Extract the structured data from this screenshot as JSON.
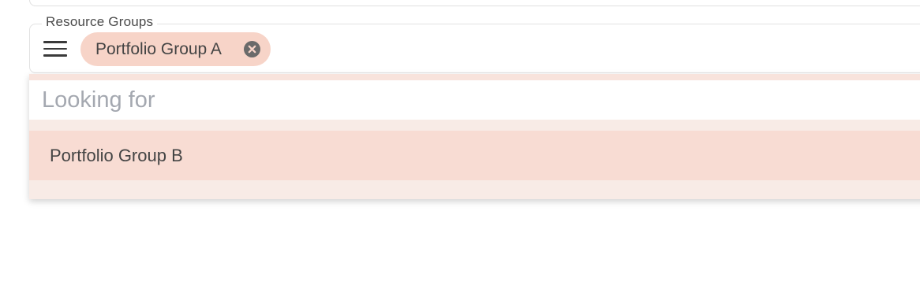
{
  "resource_groups": {
    "label": "Resource Groups",
    "menu_icon": "hamburger-menu-icon",
    "selected_chips": [
      {
        "label": "Portfolio Group A",
        "remove_icon": "close-circle-icon"
      }
    ]
  },
  "dropdown": {
    "search_placeholder": "Looking for",
    "search_value": "",
    "options": [
      {
        "label": "Portfolio Group B",
        "highlighted": true
      }
    ]
  },
  "colors": {
    "chip_background": "#f7d4c8",
    "option_highlight": "#f8dcd3",
    "dropdown_background": "#f8ebe6",
    "placeholder_text": "#a4a8b0",
    "border": "#e2e2e2"
  }
}
